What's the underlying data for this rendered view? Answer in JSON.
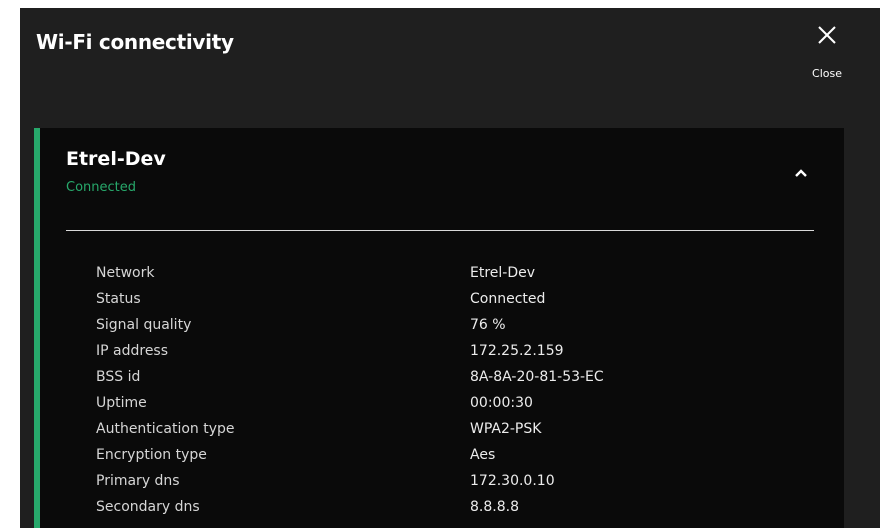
{
  "dialog": {
    "title": "Wi-Fi connectivity",
    "close_label": "Close",
    "close_icon": "close-icon"
  },
  "colors": {
    "accent": "#27a86b",
    "connected": "#27a86b"
  },
  "network": {
    "name": "Etrel-Dev",
    "status": "Connected",
    "expanded": true,
    "collapse_icon": "chevron-up-icon",
    "details": [
      {
        "label": "Network",
        "value": "Etrel-Dev"
      },
      {
        "label": "Status",
        "value": "Connected"
      },
      {
        "label": "Signal quality",
        "value": "76 %"
      },
      {
        "label": "IP address",
        "value": "172.25.2.159"
      },
      {
        "label": "BSS id",
        "value": "8A-8A-20-81-53-EC"
      },
      {
        "label": "Uptime",
        "value": "00:00:30"
      },
      {
        "label": "Authentication type",
        "value": "WPA2-PSK"
      },
      {
        "label": "Encryption type",
        "value": "Aes"
      },
      {
        "label": "Primary dns",
        "value": "172.30.0.10"
      },
      {
        "label": "Secondary dns",
        "value": "8.8.8.8"
      }
    ]
  }
}
